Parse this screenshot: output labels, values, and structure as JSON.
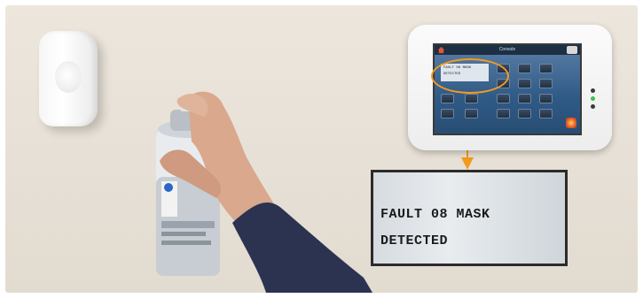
{
  "zoom_display": {
    "line1": "FAULT 08 MASK",
    "line2": "DETECTED"
  },
  "keypad": {
    "screen_title": "Console",
    "message_line1": "FAULT 08 MASK",
    "message_line2": "DETECTED",
    "icons": [
      "home-icon",
      "back-icon",
      "alarm-icon"
    ]
  },
  "colors": {
    "callout": "#f39a1e",
    "wall": "#e7e0d6",
    "screen": "#2f5a86"
  }
}
